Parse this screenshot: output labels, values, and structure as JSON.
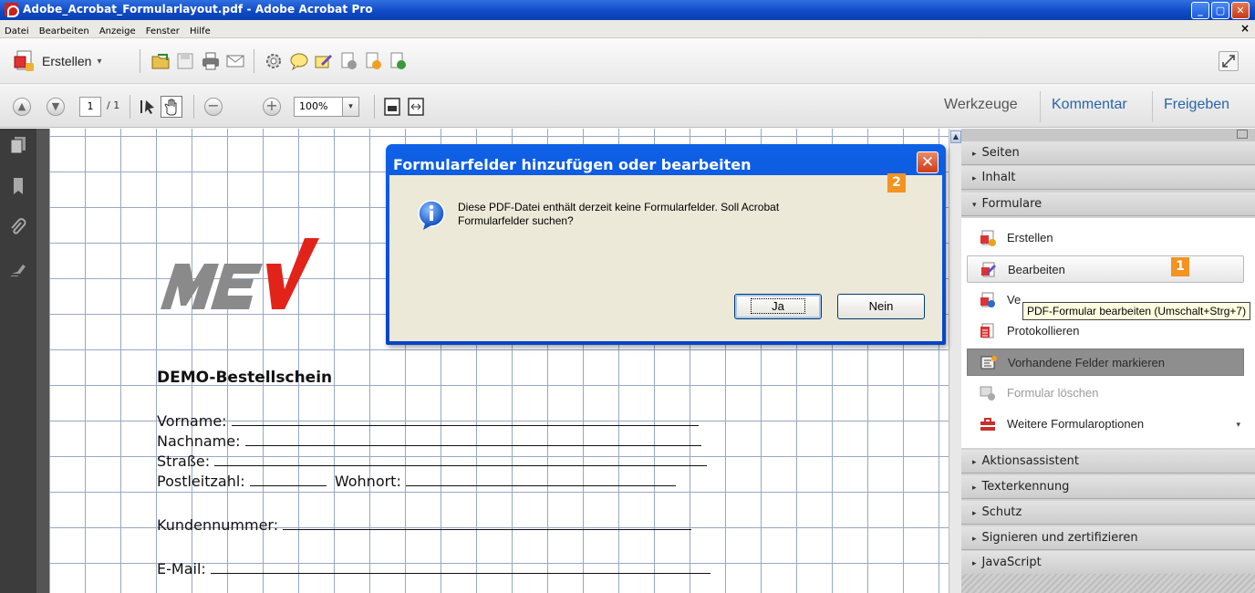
{
  "window": {
    "title": "Adobe_Acrobat_Formularlayout.pdf - Adobe Acrobat Pro"
  },
  "menubar": {
    "items": [
      "Datei",
      "Bearbeiten",
      "Anzeige",
      "Fenster",
      "Hilfe"
    ],
    "close_glyph": "×"
  },
  "toolbar": {
    "create_label": "Erstellen",
    "create_caret": "▾"
  },
  "nav": {
    "page_current": "1",
    "page_total": "/ 1",
    "zoom": "100%",
    "zoom_caret": "▾"
  },
  "panel_tabs": {
    "tools": "Werkzeuge",
    "comment": "Kommentar",
    "share": "Freigeben"
  },
  "document": {
    "form_title": "DEMO-Bestellschein",
    "fields": {
      "first_name": "Vorname:",
      "last_name": "Nachname:",
      "street": "Straße:",
      "postcode": "Postleitzahl:",
      "city": "Wohnort:",
      "customer_number": "Kundennummer:",
      "email": "E-Mail:"
    }
  },
  "right_panel": {
    "sections": {
      "pages": "Seiten",
      "content": "Inhalt",
      "forms": "Formulare",
      "action_wizard": "Aktionsassistent",
      "text_recognition": "Texterkennung",
      "protection": "Schutz",
      "sign": "Signieren und zertifizieren",
      "javascript": "JavaScript"
    },
    "form_items": {
      "create": "Erstellen",
      "edit": "Bearbeiten",
      "distribute_partial": "Ve",
      "track": "Protokollieren",
      "highlight_fields": "Vorhandene Felder markieren",
      "clear_form": "Formular löschen",
      "more_options": "Weitere Formularoptionen"
    },
    "more_caret": "▾",
    "collapsed_arrow": "▸",
    "expanded_arrow": "▾"
  },
  "tooltip": {
    "text": "PDF-Formular bearbeiten (Umschalt+Strg+7)"
  },
  "dialog": {
    "title": "Formularfelder hinzufügen oder bearbeiten",
    "close_glyph": "✕",
    "message_line1": "Diese PDF-Datei enthält derzeit keine Formularfelder. Soll Acrobat",
    "message_line2": "Formularfelder suchen?",
    "yes": "Ja",
    "no": "Nein"
  },
  "badges": {
    "one": "1",
    "two": "2"
  },
  "colors": {
    "titlebar": "#0e48c4",
    "accent_badge": "#f39321",
    "tab_blue": "#2a64a8",
    "grid": "#98a7c4",
    "logo_red": "#e2231a",
    "logo_gray": "#8a8a8a"
  },
  "icons": {
    "app": "acrobat-pdf-icon",
    "create": "create-pdf-icon",
    "open": "folder-open-icon",
    "save": "save-icon",
    "print": "printer-icon",
    "email": "envelope-icon",
    "settings": "gear-icon",
    "comment": "speech-bubble-icon",
    "sign": "pen-icon",
    "info": "info-icon"
  }
}
